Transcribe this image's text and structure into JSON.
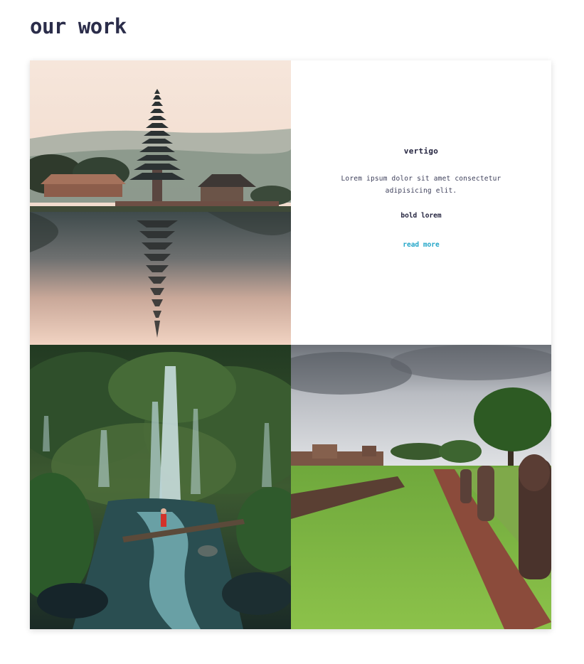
{
  "section": {
    "title": "our work"
  },
  "images": {
    "temple": "pagoda temple on a lake at sunrise",
    "waterfall": "jungle waterfall with a hiker on a wooden bridge",
    "ruins": "ancient stone ruins with a grassy path"
  },
  "card": {
    "title": "vertigo",
    "text": "Lorem ipsum dolor sit amet consectetur adipisicing elit.",
    "bold": "bold lorem",
    "link": "read more"
  },
  "colors": {
    "heading": "#2b2d4a",
    "link": "#23a6c8"
  }
}
